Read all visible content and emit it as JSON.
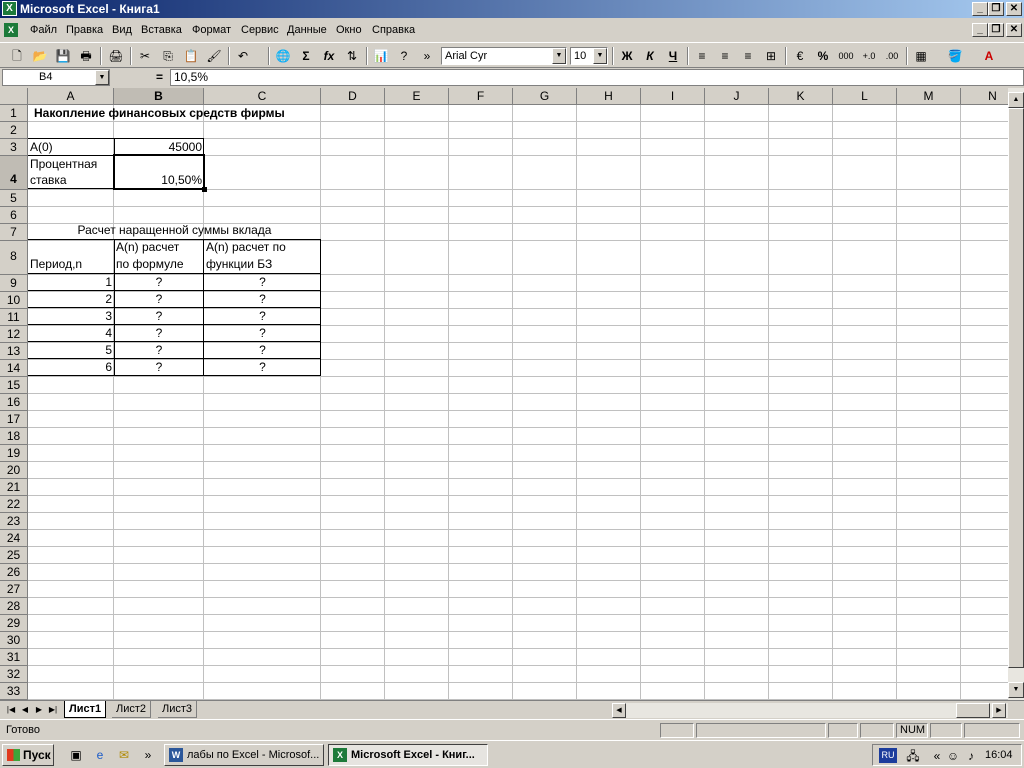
{
  "window": {
    "title": "Microsoft Excel - Книга1",
    "app_icon": "excel-icon"
  },
  "menu": {
    "items": [
      "Файл",
      "Правка",
      "Вид",
      "Вставка",
      "Формат",
      "Сервис",
      "Данные",
      "Окно",
      "Справка"
    ]
  },
  "toolbar": {
    "font_name": "Arial Cyr",
    "font_size": "10",
    "bold": "Ж",
    "italic": "К",
    "underline": "Ч",
    "sum": "Σ",
    "fx": "fx",
    "percent": "%",
    "thousands": "000"
  },
  "formula_bar": {
    "cell_ref": "B4",
    "equals": "=",
    "value": "10,5%"
  },
  "columns": [
    "A",
    "B",
    "C",
    "D",
    "E",
    "F",
    "G",
    "H",
    "I",
    "J",
    "K",
    "L",
    "M",
    "N"
  ],
  "rows": [
    "1",
    "2",
    "3",
    "4",
    "5",
    "6",
    "7",
    "8",
    "9",
    "10",
    "11",
    "12",
    "13",
    "14",
    "15",
    "16",
    "17",
    "18",
    "19",
    "20",
    "21",
    "22",
    "23",
    "24",
    "25",
    "26",
    "27",
    "28",
    "29",
    "30",
    "31",
    "32",
    "33"
  ],
  "cells": {
    "title": "Накопление финансовых средств фирмы",
    "a3": "A(0)",
    "b3": "45000",
    "a4_line1": "Процентная",
    "a4_line2": "ставка",
    "b4": "10,50%",
    "a7": "Расчет наращенной суммы вклада",
    "a8": "Период,n",
    "b8_line1": "A(n) расчет",
    "b8_line2": "по формуле",
    "c8_line1": "A(n) расчет по",
    "c8_line2": "функции БЗ",
    "table_rows": [
      {
        "n": "1",
        "b": "?",
        "c": "?"
      },
      {
        "n": "2",
        "b": "?",
        "c": "?"
      },
      {
        "n": "3",
        "b": "?",
        "c": "?"
      },
      {
        "n": "4",
        "b": "?",
        "c": "?"
      },
      {
        "n": "5",
        "b": "?",
        "c": "?"
      },
      {
        "n": "6",
        "b": "?",
        "c": "?"
      }
    ]
  },
  "sheets": [
    "Лист1",
    "Лист2",
    "Лист3"
  ],
  "status": {
    "ready": "Готово",
    "num": "NUM"
  },
  "taskbar": {
    "start": "Пуск",
    "tasks": [
      {
        "label": "лабы по Excel - Microsof..."
      },
      {
        "label": "Microsoft Excel - Книг..."
      }
    ],
    "lang": "RU",
    "clock": "16:04"
  }
}
